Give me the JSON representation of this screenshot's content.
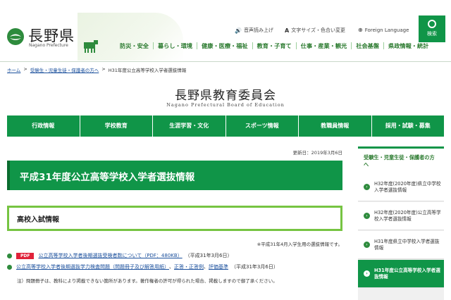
{
  "header": {
    "logo": "長野県",
    "logo_sub": "Nagano Prefecture",
    "utils": [
      {
        "icon": "speaker-icon",
        "glyph": "🔊",
        "label": "音声読み上げ"
      },
      {
        "icon": "font-size-icon",
        "glyph": "A",
        "label": "文字サイズ・色合い変更"
      },
      {
        "icon": "globe-icon",
        "glyph": "⊕",
        "label": "Foreign Language"
      }
    ],
    "search_label": "検索",
    "nav": [
      "防災・安全",
      "暮らし・環境",
      "健康・医療・福祉",
      "教育・子育て",
      "仕事・産業・観光",
      "社会基盤",
      "県政情報・統計"
    ]
  },
  "breadcrumb": {
    "links": [
      "ホーム",
      "受験生・児童生徒・保護者の方へ"
    ],
    "sep": ">",
    "current": "H31年度公立高等学校入学者選抜情報"
  },
  "board": {
    "title": "長野県教育委員会",
    "subtitle": "Nagano Prefectural Board of Education"
  },
  "global_nav": [
    "行政情報",
    "学校教育",
    "生涯学習・文化",
    "スポーツ情報",
    "教職員情報",
    "採用・試験・募集"
  ],
  "main": {
    "updated": "更新日：2019年3月6日",
    "title": "平成31年度公立高等学校入学者選抜情報",
    "section_title": "高校入試情報",
    "section_note": "※平成31年4月入学生用の選抜情報です。",
    "item1": {
      "badge": "PDF",
      "link": "公立高等学校入学者後期選抜受検者数について（PDF：480KB）",
      "date": "（平成31年3月6日）"
    },
    "item2": {
      "link_a": "公立高等学校入学者後期選抜学力検査問題（問題冊子及び解答用紙）",
      "sep1": "、",
      "link_b": "正答・正答例",
      "sep2": "、",
      "link_c": "評価基準",
      "date": "（平成31年3月6日）"
    },
    "footnote": "注）問題冊子は、教科により掲載できない箇所があります。著作権者の許可が得られた場合、掲載しますので御了承ください。"
  },
  "sidebar": {
    "heading": "受験生・児童生徒・保護者の方へ",
    "items": [
      {
        "label": "H32年度(2020年度)県立中学校入学者選抜情報"
      },
      {
        "label": "H32年度(2020年度)公立高等学校入学者選抜情報"
      },
      {
        "label": "H31年度県立中学校入学者選抜情報"
      },
      {
        "label": "H31年度公立高等学校入学者選抜情報"
      }
    ]
  },
  "colors": {
    "brand_green": "#109548",
    "accent_lime": "#76c442",
    "pdf_red": "#e0223a",
    "link_blue": "#1a4f9c"
  }
}
